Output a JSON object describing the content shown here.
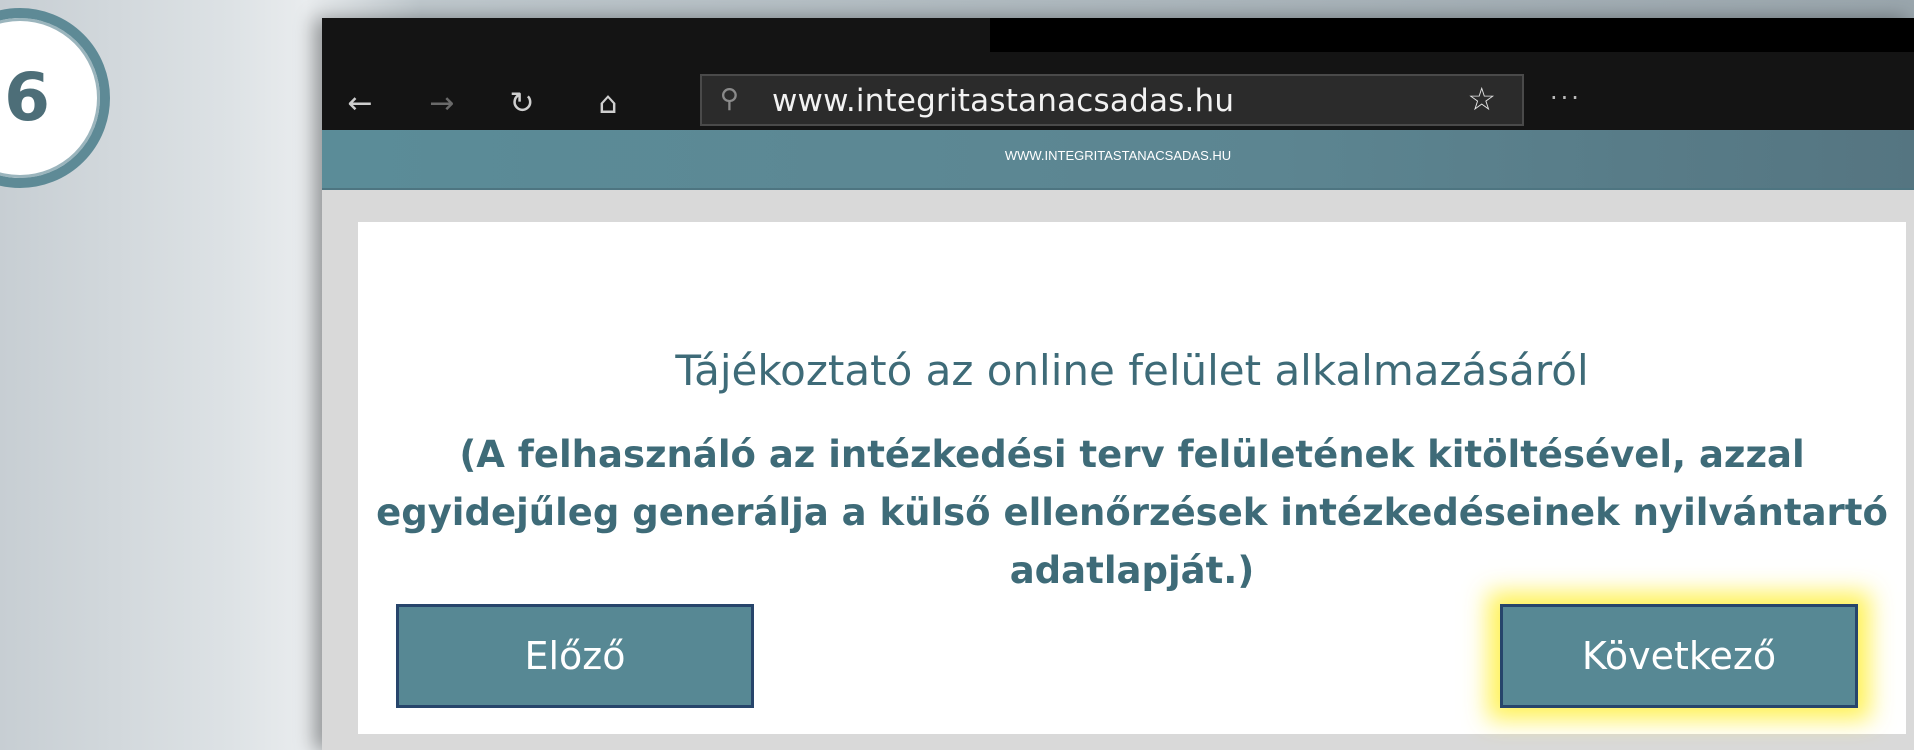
{
  "step": {
    "number": "6"
  },
  "browser": {
    "url": "www.integritastanacsadas.hu",
    "nav": {
      "back_icon": "←",
      "forward_icon": "→",
      "refresh_icon": "↻",
      "home_icon": "⌂",
      "search_icon": "⚲",
      "favorite_icon": "☆",
      "more_icon": "···"
    }
  },
  "site": {
    "header_text": "WWW.INTEGRITASTANACSADAS.HU",
    "title": "Tájékoztató az online felület alkalmazásáról",
    "subtitle": "(A felhasználó az intézkedési terv felületének kitöltésével, azzal egyidejűleg generálja a külső ellenőrzések intézkedéseinek nyilvántartó adatlapját.)",
    "prev_label": "Előző",
    "next_label": "Következő"
  },
  "colors": {
    "accent": "#578894",
    "text": "#3e6b78",
    "highlight": "#fff03c"
  }
}
